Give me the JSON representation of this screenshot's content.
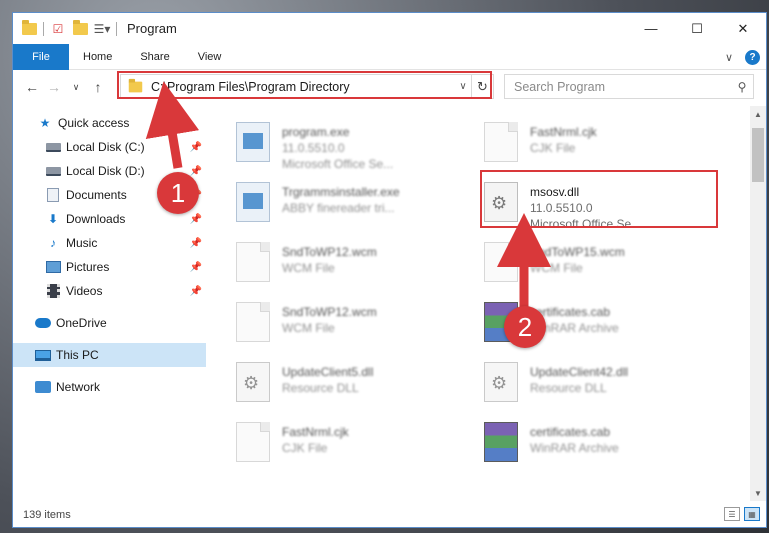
{
  "window": {
    "title": "Program",
    "controls": {
      "minimize": "—",
      "maximize": "☐",
      "close": "✕"
    }
  },
  "ribbon": {
    "tabs": [
      "File",
      "Home",
      "Share",
      "View"
    ],
    "expand": "∨",
    "help": "?"
  },
  "navigation": {
    "address": "C:\\Program Files\\Program Directory",
    "search_placeholder": "Search Program"
  },
  "sidebar": {
    "items": [
      {
        "label": "Quick access",
        "icon": "star-icon",
        "pinned": false
      },
      {
        "label": "Local Disk (C:)",
        "icon": "drive-icon",
        "pinned": true
      },
      {
        "label": "Local Disk (D:)",
        "icon": "drive-icon",
        "pinned": true
      },
      {
        "label": "Documents",
        "icon": "documents-icon",
        "pinned": true
      },
      {
        "label": "Downloads",
        "icon": "downloads-icon",
        "pinned": true
      },
      {
        "label": "Music",
        "icon": "music-icon",
        "pinned": true
      },
      {
        "label": "Pictures",
        "icon": "pictures-icon",
        "pinned": true
      },
      {
        "label": "Videos",
        "icon": "videos-icon",
        "pinned": true
      },
      {
        "label": "OneDrive",
        "icon": "onedrive-icon",
        "pinned": false
      },
      {
        "label": "This PC",
        "icon": "this-pc-icon",
        "pinned": false,
        "selected": true
      },
      {
        "label": "Network",
        "icon": "network-icon",
        "pinned": false
      }
    ]
  },
  "files": [
    {
      "name": "program.exe",
      "line2": "11.0.5510.0",
      "line3": "Microsoft Office Se...",
      "icon": "exe"
    },
    {
      "name": "FastNrml.cjk",
      "line2": "CJK File",
      "line3": "",
      "icon": "doc"
    },
    {
      "name": "Trgrammsinstaller.exe",
      "line2": "ABBY finereader tri...",
      "line3": "",
      "icon": "exe"
    },
    {
      "name": "msosv.dll",
      "line2": "11.0.5510.0",
      "line3": "Microsoft Office Se...",
      "icon": "dll"
    },
    {
      "name": "SndToWP12.wcm",
      "line2": "WCM File",
      "line3": "",
      "icon": "doc"
    },
    {
      "name": "SndToWP15.wcm",
      "line2": "WCM File",
      "line3": "",
      "icon": "doc"
    },
    {
      "name": "SndToWP12.wcm",
      "line2": "WCM File",
      "line3": "",
      "icon": "doc"
    },
    {
      "name": "certificates.cab",
      "line2": "WinRAR Archive",
      "line3": "",
      "icon": "cab"
    },
    {
      "name": "UpdateClient5.dll",
      "line2": "Resource DLL",
      "line3": "",
      "icon": "dll"
    },
    {
      "name": "UpdateClient42.dll",
      "line2": "Resource DLL",
      "line3": "",
      "icon": "dll"
    },
    {
      "name": "FastNrml.cjk",
      "line2": "CJK File",
      "line3": "",
      "icon": "doc"
    },
    {
      "name": "certificates.cab",
      "line2": "WinRAR Archive",
      "line3": "",
      "icon": "cab"
    }
  ],
  "status": {
    "count": "139 items"
  },
  "annotations": {
    "step1": "1",
    "step2": "2"
  },
  "colors": {
    "accent": "#1979ca",
    "annotation": "#d9383a",
    "selection": "#cce4f7"
  }
}
